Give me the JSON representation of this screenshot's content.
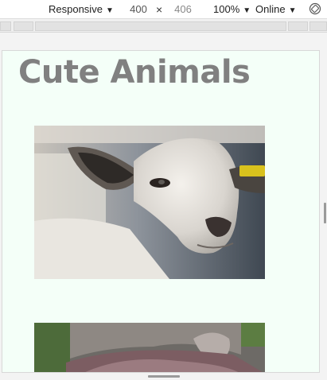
{
  "toolbar": {
    "device": "Responsive",
    "width": "400",
    "times": "×",
    "height": "406",
    "zoom": "100%",
    "throttle": "Online",
    "arrow": "▼"
  },
  "page": {
    "title": "Cute Animals",
    "background": "#f4fff8",
    "title_color": "#808080"
  },
  "images": [
    {
      "subject": "goat"
    },
    {
      "subject": "koala"
    }
  ]
}
